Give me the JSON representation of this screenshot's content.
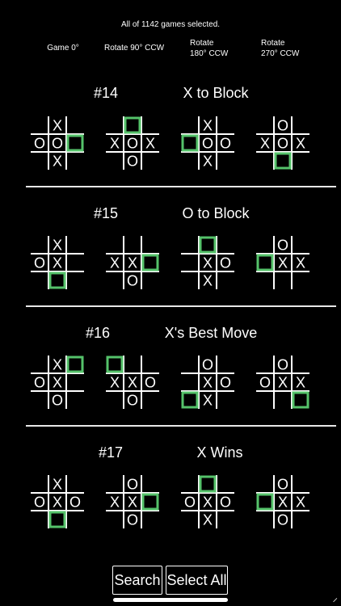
{
  "summary": "All of 1142 games selected.",
  "columns": [
    {
      "line1": "Game 0°",
      "line2": ""
    },
    {
      "line1": "Rotate 90° CCW",
      "line2": ""
    },
    {
      "line1": "Rotate",
      "line2": "180° CCW"
    },
    {
      "line1": "Rotate",
      "line2": "270° CCW"
    }
  ],
  "highlight_color": "#55c26a",
  "sections": [
    {
      "number": "#14",
      "title": "X to Block",
      "boards": [
        {
          "cells": [
            "",
            "X",
            "",
            "O",
            "O",
            "",
            "",
            "X",
            ""
          ],
          "highlight": 5
        },
        {
          "cells": [
            "",
            "",
            "",
            "X",
            "O",
            "X",
            "",
            "O",
            ""
          ],
          "highlight": 1
        },
        {
          "cells": [
            "",
            "X",
            "",
            "",
            "O",
            "O",
            "",
            "X",
            ""
          ],
          "highlight": 3
        },
        {
          "cells": [
            "",
            "O",
            "",
            "X",
            "O",
            "X",
            "",
            "",
            ""
          ],
          "highlight": 7
        }
      ]
    },
    {
      "number": "#15",
      "title": "O to Block",
      "boards": [
        {
          "cells": [
            "",
            "X",
            "",
            "O",
            "X",
            "",
            "",
            "",
            ""
          ],
          "highlight": 7
        },
        {
          "cells": [
            "",
            "",
            "",
            "X",
            "X",
            "",
            "",
            "O",
            ""
          ],
          "highlight": 5
        },
        {
          "cells": [
            "",
            "",
            "",
            "",
            "X",
            "O",
            "",
            "X",
            ""
          ],
          "highlight": 1
        },
        {
          "cells": [
            "",
            "O",
            "",
            "",
            "X",
            "X",
            "",
            "",
            ""
          ],
          "highlight": 3
        }
      ]
    },
    {
      "number": "#16",
      "title": "X's Best Move",
      "boards": [
        {
          "cells": [
            "",
            "X",
            "",
            "O",
            "X",
            "",
            "",
            "O",
            ""
          ],
          "highlight": 2
        },
        {
          "cells": [
            "",
            "",
            "",
            "X",
            "X",
            "O",
            "",
            "O",
            ""
          ],
          "highlight": 0
        },
        {
          "cells": [
            "",
            "O",
            "",
            "",
            "X",
            "O",
            "",
            "X",
            ""
          ],
          "highlight": 6
        },
        {
          "cells": [
            "",
            "O",
            "",
            "O",
            "X",
            "X",
            "",
            "",
            ""
          ],
          "highlight": 8
        }
      ]
    },
    {
      "number": "#17",
      "title": "X Wins",
      "boards": [
        {
          "cells": [
            "",
            "X",
            "",
            "O",
            "X",
            "O",
            "",
            "",
            ""
          ],
          "highlight": 7
        },
        {
          "cells": [
            "",
            "O",
            "",
            "X",
            "X",
            "",
            "",
            "O",
            ""
          ],
          "highlight": 5
        },
        {
          "cells": [
            "",
            "",
            "",
            "O",
            "X",
            "O",
            "",
            "X",
            ""
          ],
          "highlight": 1
        },
        {
          "cells": [
            "",
            "O",
            "",
            "",
            "X",
            "X",
            "",
            "O",
            ""
          ],
          "highlight": 3
        }
      ]
    }
  ],
  "buttons": {
    "search": "Search",
    "select_all": "Select All"
  },
  "corner_mark": "⸝"
}
